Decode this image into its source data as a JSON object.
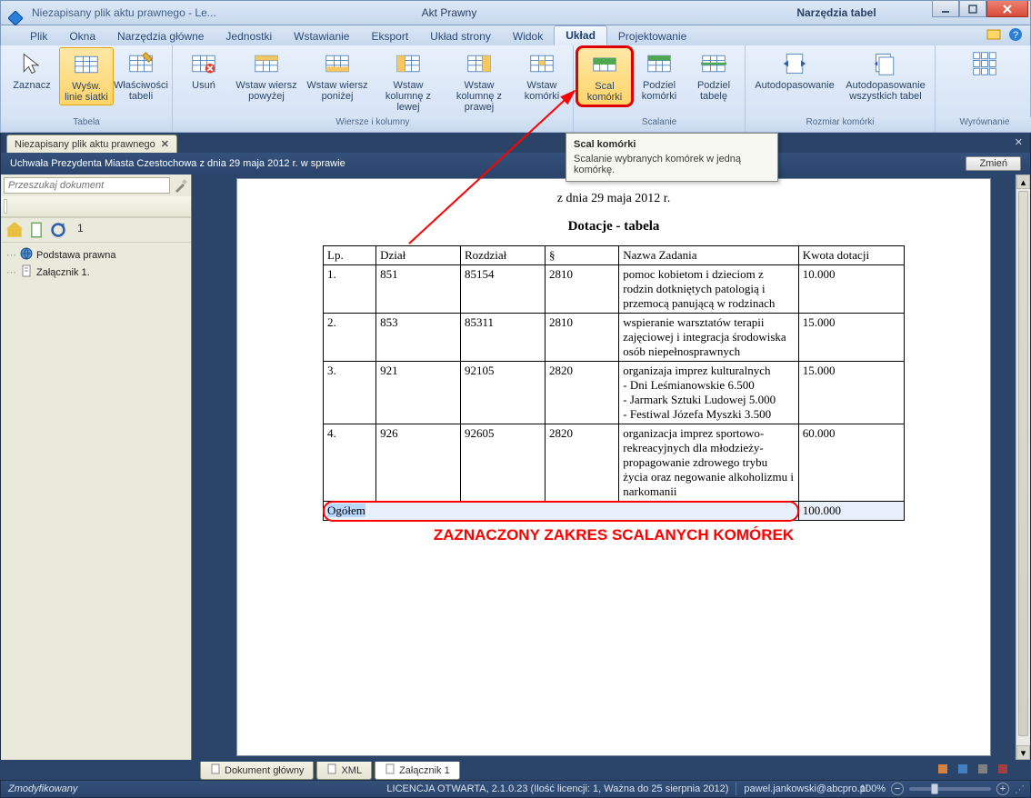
{
  "titlebar": {
    "left": "Niezapisany plik aktu prawnego - Le...",
    "center": "Akt Prawny",
    "right": "Narzędzia tabel"
  },
  "menu_tabs": [
    "Plik",
    "Okna",
    "Narzędzia główne",
    "Jednostki",
    "Wstawianie",
    "Eksport",
    "Układ strony",
    "Widok",
    "Układ",
    "Projektowanie"
  ],
  "active_menu_tab": "Układ",
  "ribbon": {
    "groups": [
      {
        "label": "Tabela",
        "buttons": [
          {
            "name": "zaznacz",
            "label": "Zaznacz",
            "icon": "cursor"
          },
          {
            "name": "wysw-linie-siatki",
            "label": "Wyśw. linie siatki",
            "icon": "grid",
            "highlight": true
          },
          {
            "name": "wlasciwosci-tabeli",
            "label": "Właściwości tabeli",
            "icon": "table-edit"
          }
        ]
      },
      {
        "label": "Wiersze i kolumny",
        "buttons": [
          {
            "name": "usun",
            "label": "Usuń",
            "icon": "table-delete"
          },
          {
            "name": "wstaw-wiersz-powyzej",
            "label": "Wstaw wiersz powyżej",
            "icon": "row-above",
            "wide": true
          },
          {
            "name": "wstaw-wiersz-ponizej",
            "label": "Wstaw wiersz poniżej",
            "icon": "row-below",
            "wide": true
          },
          {
            "name": "wstaw-kolumne-z-lewej",
            "label": "Wstaw kolumnę z lewej",
            "icon": "col-left",
            "wide": true
          },
          {
            "name": "wstaw-kolumne-z-prawej",
            "label": "Wstaw kolumnę z prawej",
            "icon": "col-right",
            "wide": true
          },
          {
            "name": "wstaw-komorki",
            "label": "Wstaw komórki",
            "icon": "cells"
          }
        ]
      },
      {
        "label": "Scalanie",
        "buttons": [
          {
            "name": "scal-komorki",
            "label": "Scal komórki",
            "icon": "merge",
            "highlight": true,
            "red": true
          },
          {
            "name": "podziel-komorki",
            "label": "Podziel komórki",
            "icon": "split"
          },
          {
            "name": "podziel-tabele",
            "label": "Podziel tabelę",
            "icon": "split-table"
          }
        ]
      },
      {
        "label": "Rozmiar komórki",
        "buttons": [
          {
            "name": "autodopasowanie",
            "label": "Autodopasowanie",
            "icon": "autofit",
            "vwide": true
          },
          {
            "name": "autodopasowanie-wszystkich-tabel",
            "label": "Autodopasowanie wszystkich tabel",
            "icon": "autofit-all",
            "vwide": true
          }
        ]
      },
      {
        "label": "Wyrównanie",
        "buttons": [
          {
            "name": "wyrownanie",
            "label": "",
            "icon": "align-grid",
            "vwide": true
          }
        ]
      }
    ]
  },
  "tooltip": {
    "title": "Scal komórki",
    "body": "Scalanie wybranych komórek w jedną komórkę."
  },
  "doc_tab": {
    "label": "Niezapisany plik aktu prawnego"
  },
  "header_bar": {
    "title": "Uchwała Prezydenta Miasta Czestochowa z dnia 29 maja 2012 r. w sprawie",
    "change": "Zmień"
  },
  "search_placeholder": "Przeszukaj dokument",
  "nav_count": "1",
  "tree": {
    "items": [
      {
        "label": "Podstawa prawna",
        "icon": "globe"
      },
      {
        "label": "Załącznik 1.",
        "icon": "doc"
      }
    ]
  },
  "doc": {
    "date": "z dnia 29 maja 2012 r.",
    "title": "Dotacje - tabela",
    "headers": [
      "Lp.",
      "Dział",
      "Rozdział",
      "§",
      "Nazwa Zadania",
      "Kwota dotacji"
    ],
    "rows": [
      {
        "lp": "1.",
        "dzial": "851",
        "rozdzial": "85154",
        "par": "2810",
        "nazwa": "pomoc kobietom i dzieciom z rodzin dotkniętych patologią i przemocą panującą w rodzinach",
        "kwota": "10.000"
      },
      {
        "lp": "2.",
        "dzial": "853",
        "rozdzial": "85311",
        "par": "2810",
        "nazwa": "wspieranie warsztatów terapii zajęciowej i integracja środowiska osób niepełnosprawnych",
        "kwota": "15.000"
      },
      {
        "lp": "3.",
        "dzial": "921",
        "rozdzial": "92105",
        "par": "2820",
        "nazwa": "organizaja imprez kulturalnych\n- Dni Leśmianowskie 6.500\n- Jarmark Sztuki Ludowej 5.000\n- Festiwal Józefa Myszki 3.500",
        "kwota": "15.000"
      },
      {
        "lp": "4.",
        "dzial": "926",
        "rozdzial": "92605",
        "par": "2820",
        "nazwa": "organizacja imprez sportowo-rekreacyjnych dla młodzieży- propagowanie zdrowego trybu życia oraz negowanie alkoholizmu i narkomanii",
        "kwota": "60.000"
      }
    ],
    "total_row": {
      "label": "Ogółem",
      "kwota": "100.000"
    },
    "annotation": "ZAZNACZONY ZAKRES SCALANYCH KOMÓREK"
  },
  "bottom_tabs": {
    "items": [
      {
        "label": "Dokument główny",
        "icon": "doc"
      },
      {
        "label": "XML",
        "icon": "xml"
      },
      {
        "label": "Załącznik 1",
        "icon": "attach",
        "active": true
      }
    ]
  },
  "status": {
    "left": "Zmodyfikowany",
    "license": "LICENCJA OTWARTA, 2.1.0.23 (Ilość licencji: 1, Ważna do 25 sierpnia 2012)",
    "email": "pawel.jankowski@abcpro.pl",
    "zoom": "100%"
  }
}
